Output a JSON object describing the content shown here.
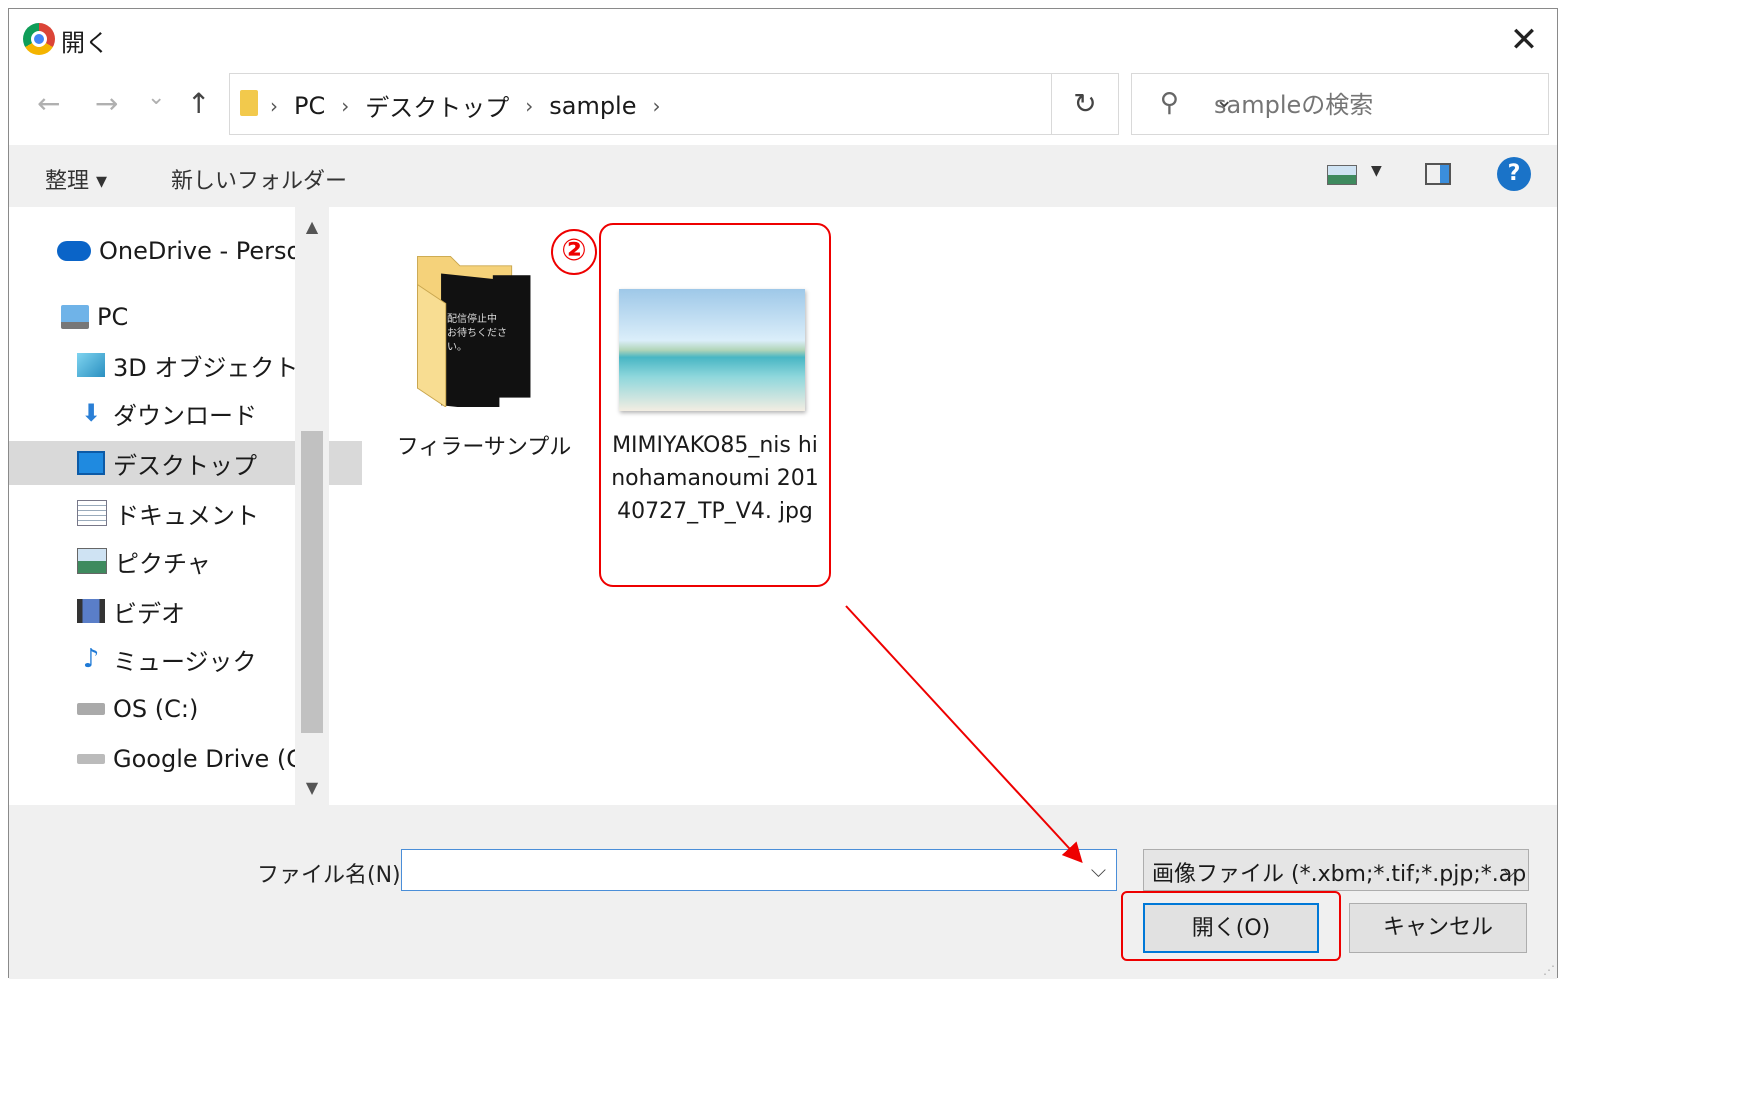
{
  "window": {
    "title": "開く",
    "close_glyph": "✕"
  },
  "nav": {
    "back": "←",
    "forward": "→",
    "recent": "⌄",
    "up": "↑"
  },
  "address": {
    "crumbs": [
      "PC",
      "デスクトップ",
      "sample"
    ],
    "separator": "›",
    "dropdown": "⌄",
    "refresh": "↻"
  },
  "search": {
    "placeholder": "sampleの検索",
    "icon": "⚲"
  },
  "toolbar": {
    "organize": "整理 ▾",
    "new_folder": "新しいフォルダー",
    "view_dd": "▼",
    "help": "?"
  },
  "sidebar": {
    "items": [
      {
        "label": "OneDrive - Persor",
        "icon": "onedrive-icon"
      },
      {
        "label": "PC",
        "icon": "pc-icon"
      },
      {
        "label": "3D オブジェクト",
        "icon": "3d-objects-icon"
      },
      {
        "label": "ダウンロード",
        "icon": "download-icon"
      },
      {
        "label": "デスクトップ",
        "icon": "desktop-icon",
        "selected": true
      },
      {
        "label": "ドキュメント",
        "icon": "documents-icon"
      },
      {
        "label": "ピクチャ",
        "icon": "pictures-icon"
      },
      {
        "label": "ビデオ",
        "icon": "video-icon"
      },
      {
        "label": "ミュージック",
        "icon": "music-icon"
      },
      {
        "label": "OS (C:)",
        "icon": "drive-icon"
      },
      {
        "label": "Google Drive (G:",
        "icon": "drive-icon"
      }
    ],
    "scroll_up": "▲",
    "scroll_down": "▼"
  },
  "files": [
    {
      "name": "フィラーサンプル",
      "type": "folder",
      "thumb_text": "配信停止中 お待ちください。"
    },
    {
      "name": "MIMIYAKO85_nis hinohamanoumi 20140727_TP_V4. jpg",
      "type": "image"
    }
  ],
  "annotation": {
    "badge": "②"
  },
  "bottom": {
    "filename_label": "ファイル名(N):",
    "filename_value": "",
    "filetype": "画像ファイル (*.xbm;*.tif;*.pjp;*.ap",
    "open": "開く(O)",
    "cancel": "キャンセル",
    "dropdown": "⌵"
  }
}
